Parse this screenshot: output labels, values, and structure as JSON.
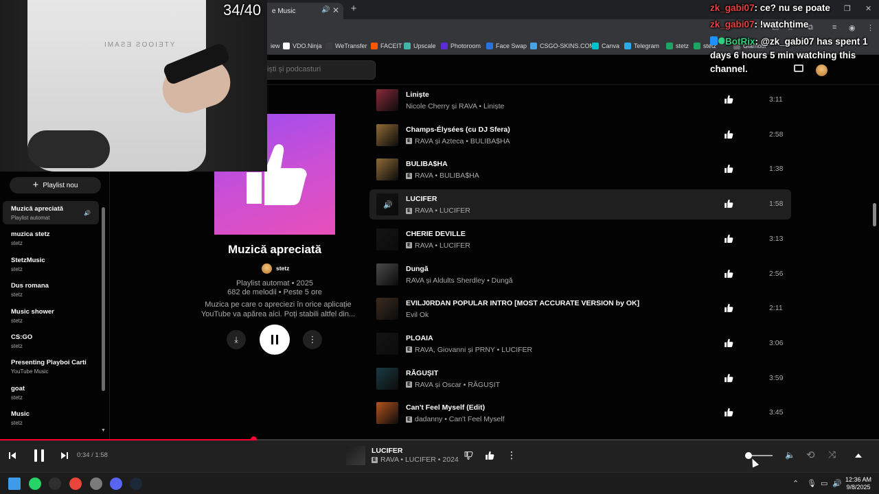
{
  "browser": {
    "tab_title": "e Music",
    "bookmarks": [
      {
        "label": "iew",
        "color": "#35363a"
      },
      {
        "label": "VDO.Ninja",
        "color": "#ffffff"
      },
      {
        "label": "WeTransfer",
        "color": "#3b3b3b"
      },
      {
        "label": "FACEIT",
        "color": "#ff5500"
      },
      {
        "label": "Upscale",
        "color": "#3fb6a8"
      },
      {
        "label": "Photoroom",
        "color": "#5b2bd6"
      },
      {
        "label": "Face Swap",
        "color": "#2f6fe0"
      },
      {
        "label": "CSGO-SKINS.COM",
        "color": "#4aa3df"
      },
      {
        "label": "Canva",
        "color": "#00c4cc"
      },
      {
        "label": "Telegram",
        "color": "#2aabee"
      },
      {
        "label": "stetz",
        "color": "#1ea362"
      },
      {
        "label": "stetz",
        "color": "#1ea362"
      },
      {
        "label": "Glamour",
        "color": "#6b6b6b"
      }
    ]
  },
  "search": {
    "placeholder": "iști și podcasturi"
  },
  "sidebar": {
    "new_playlist_label": "Playlist nou",
    "items": [
      {
        "title": "Muzică apreciată",
        "subtitle": "Playlist automat"
      },
      {
        "title": "muzica stetz",
        "subtitle": "stetz"
      },
      {
        "title": "StetzMusic",
        "subtitle": "stetz"
      },
      {
        "title": "Dus romana",
        "subtitle": "stetz"
      },
      {
        "title": "Music shower",
        "subtitle": "stetz"
      },
      {
        "title": "CS:GO",
        "subtitle": "stetz"
      },
      {
        "title": "Presenting Playboi Carti",
        "subtitle": "YouTube Music"
      },
      {
        "title": "goat",
        "subtitle": "stetz"
      },
      {
        "title": "Music",
        "subtitle": "stetz"
      }
    ]
  },
  "playlist": {
    "title": "Muzică apreciată",
    "owner": "stetz",
    "meta1": "Playlist automat • 2025",
    "meta2": "682 de melodii • Peste 5 ore",
    "desc1": "Muzica pe care o apreciezi în orice aplicație",
    "desc2": "YouTube va apărea aici. Poți stabili altfel din..."
  },
  "tracks": [
    {
      "title": "Liniște",
      "artist": "Nicole Cherry și RAVA • Liniște",
      "explicit": false,
      "duration": "3:11",
      "art": "#8a2a3a"
    },
    {
      "title": "Champs-Élysées (cu DJ Sfera)",
      "artist": "RAVA și Azteca • BULIBA$HA",
      "explicit": true,
      "duration": "2:58",
      "art": "#8f6a35"
    },
    {
      "title": "BULIBA$HA",
      "artist": "RAVA • BULIBA$HA",
      "explicit": true,
      "duration": "1:38",
      "art": "#8f6a35"
    },
    {
      "title": "LUCIFER",
      "artist": "RAVA • LUCIFER",
      "explicit": true,
      "duration": "1:58",
      "art": "#111111",
      "playing": true
    },
    {
      "title": "CHERIE DEVILLE",
      "artist": "RAVA • LUCIFER",
      "explicit": true,
      "duration": "3:13",
      "art": "#141414"
    },
    {
      "title": "Dungă",
      "artist": "RAVA și Aldults Sherdley • Dungă",
      "explicit": false,
      "duration": "2:56",
      "art": "#4a4a4a"
    },
    {
      "title": "EVILJ0RDAN POPULAR INTRO [MOST ACCURATE VERSION by OK]",
      "artist": "Evil Ok",
      "explicit": false,
      "duration": "2:11",
      "art": "#3d2b1f"
    },
    {
      "title": "PLOAIA",
      "artist": "RAVA, Giovanni și PRNY • LUCIFER",
      "explicit": true,
      "duration": "3:06",
      "art": "#141414"
    },
    {
      "title": "RĂGUȘIT",
      "artist": "RAVA și Oscar • RĂGUȘIT",
      "explicit": true,
      "duration": "3:59",
      "art": "#1d3a44"
    },
    {
      "title": "Can't Feel Myself (Edit)",
      "artist": "dadanny • Can't Feel Myself",
      "explicit": true,
      "duration": "3:45",
      "art": "#b5541d"
    }
  ],
  "stream": {
    "counter": "34/40"
  },
  "chat": [
    {
      "user": "zk_gabi07",
      "text": ": ce? nu se poate"
    },
    {
      "user": "zk_gabi07",
      "text": ": !watchtime"
    },
    {
      "user": "BotRix",
      "text": ": @zk_gabi07 has spent 1 days 6 hours 5 min watching this channel."
    }
  ],
  "player": {
    "time": "0:34 / 1:58",
    "title": "LUCIFER",
    "subtitle": "RAVA • LUCIFER • 2024",
    "progress": 0.288,
    "volume": 0.1
  },
  "taskbar": {
    "time": "12:36 AM",
    "date": "9/8/2025",
    "apps": [
      {
        "name": "windows-start-icon",
        "color": "#3d9be9"
      },
      {
        "name": "whatsapp-icon",
        "color": "#25d366"
      },
      {
        "name": "obs-icon",
        "color": "#302e31"
      },
      {
        "name": "chrome-icon",
        "color": "#e9453a"
      },
      {
        "name": "github-desktop-icon",
        "color": "#7b7b7b"
      },
      {
        "name": "discord-icon",
        "color": "#5865f2"
      },
      {
        "name": "steam-icon",
        "color": "#1b2838"
      }
    ]
  },
  "colors": {
    "accent": "#ff0033",
    "chat_user": "#e84141",
    "chat_bot": "#2fd07f"
  }
}
